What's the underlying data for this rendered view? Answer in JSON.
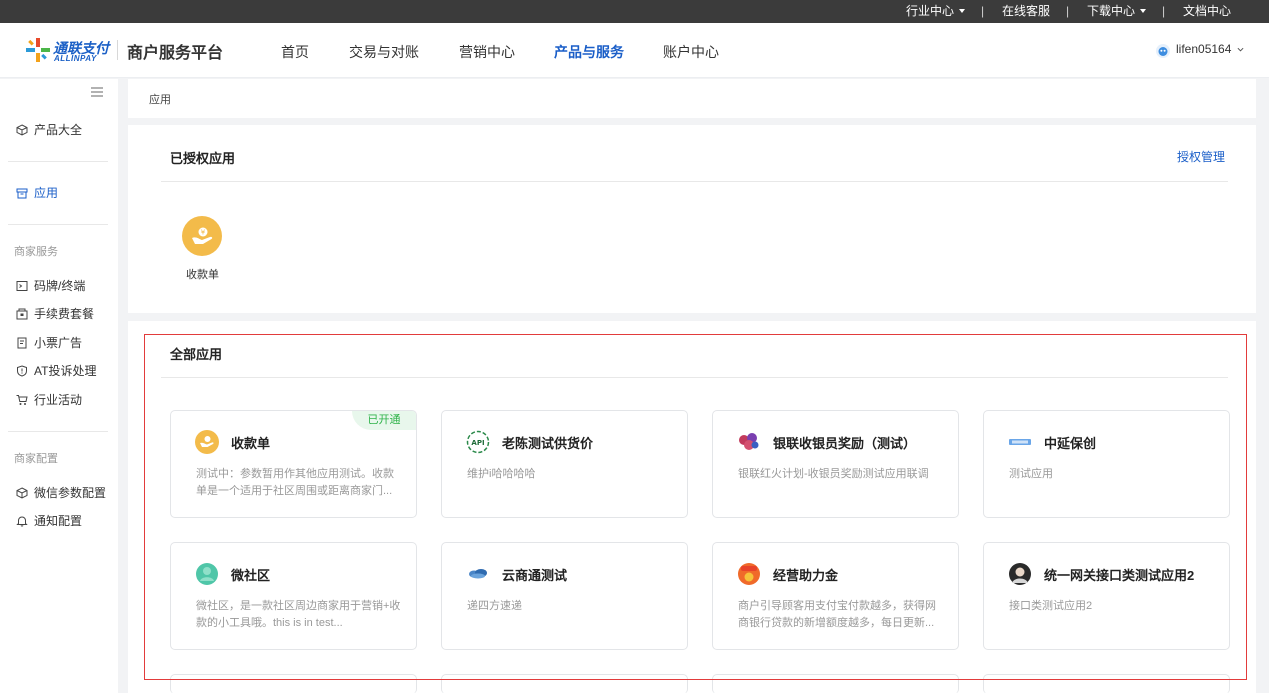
{
  "topbar": {
    "industry": "行业中心",
    "online": "在线客服",
    "download": "下载中心",
    "docs": "文档中心",
    "separator": "|"
  },
  "header": {
    "logo_cn": "通联支付",
    "logo_en": "ALLINPAY",
    "platform": "商户服务平台",
    "nav": [
      "首页",
      "交易与对账",
      "营销中心",
      "产品与服务",
      "账户中心"
    ],
    "active_nav": "产品与服务",
    "user": "lifen05164"
  },
  "sidebar": {
    "items_top": [
      {
        "label": "产品大全",
        "icon": "cube-icon"
      },
      {
        "label": "应用",
        "icon": "archive-icon",
        "active": true
      }
    ],
    "group1": "商家服务",
    "items_merchant": [
      {
        "label": "码牌/终端",
        "icon": "terminal-icon"
      },
      {
        "label": "手续费套餐",
        "icon": "package-icon"
      },
      {
        "label": "小票广告",
        "icon": "receipt-icon"
      },
      {
        "label": "AT投诉处理",
        "icon": "shield-icon"
      },
      {
        "label": "行业活动",
        "icon": "cart-icon"
      }
    ],
    "group2": "商家配置",
    "items_config": [
      {
        "label": "微信参数配置",
        "icon": "cube-icon"
      },
      {
        "label": "通知配置",
        "icon": "bell-icon"
      }
    ]
  },
  "breadcrumb": "应用",
  "authorized": {
    "title": "已授权应用",
    "manage_link": "授权管理",
    "apps": [
      {
        "label": "收款单"
      }
    ]
  },
  "all_apps": {
    "title": "全部应用",
    "apps": [
      {
        "name": "收款单",
        "desc": "测试中：参数暂用作其他应用测试。收款单是一个适用于社区周围或距离商家门...",
        "badge": "已开通"
      },
      {
        "name": "老陈测试供货价",
        "desc": "维护i哈哈哈哈"
      },
      {
        "name": "银联收银员奖励（测试）",
        "desc": "银联红火计划-收银员奖励测试应用联调"
      },
      {
        "name": "中延保创",
        "desc": "测试应用"
      },
      {
        "name": "微社区",
        "desc": "微社区，是一款社区周边商家用于营销+收款的小工具哦。this is in test..."
      },
      {
        "name": "云商通测试",
        "desc": "递四方速递"
      },
      {
        "name": "经营助力金",
        "desc": "商户引导顾客用支付宝付款越多，获得网商银行贷款的新增额度越多，每日更新..."
      },
      {
        "name": "统一网关接口类测试应用2",
        "desc": "接口类测试应用2"
      }
    ]
  },
  "colors": {
    "accent": "#1a5ec8",
    "badge_green": "#2fb34a",
    "highlight_red": "#e23b3b"
  }
}
